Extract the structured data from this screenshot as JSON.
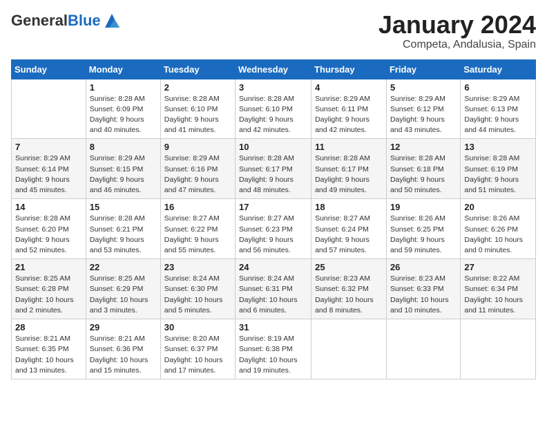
{
  "header": {
    "logo_general": "General",
    "logo_blue": "Blue",
    "month_title": "January 2024",
    "location": "Competa, Andalusia, Spain"
  },
  "weekdays": [
    "Sunday",
    "Monday",
    "Tuesday",
    "Wednesday",
    "Thursday",
    "Friday",
    "Saturday"
  ],
  "weeks": [
    [
      {
        "day": "",
        "info": ""
      },
      {
        "day": "1",
        "info": "Sunrise: 8:28 AM\nSunset: 6:09 PM\nDaylight: 9 hours\nand 40 minutes."
      },
      {
        "day": "2",
        "info": "Sunrise: 8:28 AM\nSunset: 6:10 PM\nDaylight: 9 hours\nand 41 minutes."
      },
      {
        "day": "3",
        "info": "Sunrise: 8:28 AM\nSunset: 6:10 PM\nDaylight: 9 hours\nand 42 minutes."
      },
      {
        "day": "4",
        "info": "Sunrise: 8:29 AM\nSunset: 6:11 PM\nDaylight: 9 hours\nand 42 minutes."
      },
      {
        "day": "5",
        "info": "Sunrise: 8:29 AM\nSunset: 6:12 PM\nDaylight: 9 hours\nand 43 minutes."
      },
      {
        "day": "6",
        "info": "Sunrise: 8:29 AM\nSunset: 6:13 PM\nDaylight: 9 hours\nand 44 minutes."
      }
    ],
    [
      {
        "day": "7",
        "info": "Sunrise: 8:29 AM\nSunset: 6:14 PM\nDaylight: 9 hours\nand 45 minutes."
      },
      {
        "day": "8",
        "info": "Sunrise: 8:29 AM\nSunset: 6:15 PM\nDaylight: 9 hours\nand 46 minutes."
      },
      {
        "day": "9",
        "info": "Sunrise: 8:29 AM\nSunset: 6:16 PM\nDaylight: 9 hours\nand 47 minutes."
      },
      {
        "day": "10",
        "info": "Sunrise: 8:28 AM\nSunset: 6:17 PM\nDaylight: 9 hours\nand 48 minutes."
      },
      {
        "day": "11",
        "info": "Sunrise: 8:28 AM\nSunset: 6:17 PM\nDaylight: 9 hours\nand 49 minutes."
      },
      {
        "day": "12",
        "info": "Sunrise: 8:28 AM\nSunset: 6:18 PM\nDaylight: 9 hours\nand 50 minutes."
      },
      {
        "day": "13",
        "info": "Sunrise: 8:28 AM\nSunset: 6:19 PM\nDaylight: 9 hours\nand 51 minutes."
      }
    ],
    [
      {
        "day": "14",
        "info": "Sunrise: 8:28 AM\nSunset: 6:20 PM\nDaylight: 9 hours\nand 52 minutes."
      },
      {
        "day": "15",
        "info": "Sunrise: 8:28 AM\nSunset: 6:21 PM\nDaylight: 9 hours\nand 53 minutes."
      },
      {
        "day": "16",
        "info": "Sunrise: 8:27 AM\nSunset: 6:22 PM\nDaylight: 9 hours\nand 55 minutes."
      },
      {
        "day": "17",
        "info": "Sunrise: 8:27 AM\nSunset: 6:23 PM\nDaylight: 9 hours\nand 56 minutes."
      },
      {
        "day": "18",
        "info": "Sunrise: 8:27 AM\nSunset: 6:24 PM\nDaylight: 9 hours\nand 57 minutes."
      },
      {
        "day": "19",
        "info": "Sunrise: 8:26 AM\nSunset: 6:25 PM\nDaylight: 9 hours\nand 59 minutes."
      },
      {
        "day": "20",
        "info": "Sunrise: 8:26 AM\nSunset: 6:26 PM\nDaylight: 10 hours\nand 0 minutes."
      }
    ],
    [
      {
        "day": "21",
        "info": "Sunrise: 8:25 AM\nSunset: 6:28 PM\nDaylight: 10 hours\nand 2 minutes."
      },
      {
        "day": "22",
        "info": "Sunrise: 8:25 AM\nSunset: 6:29 PM\nDaylight: 10 hours\nand 3 minutes."
      },
      {
        "day": "23",
        "info": "Sunrise: 8:24 AM\nSunset: 6:30 PM\nDaylight: 10 hours\nand 5 minutes."
      },
      {
        "day": "24",
        "info": "Sunrise: 8:24 AM\nSunset: 6:31 PM\nDaylight: 10 hours\nand 6 minutes."
      },
      {
        "day": "25",
        "info": "Sunrise: 8:23 AM\nSunset: 6:32 PM\nDaylight: 10 hours\nand 8 minutes."
      },
      {
        "day": "26",
        "info": "Sunrise: 8:23 AM\nSunset: 6:33 PM\nDaylight: 10 hours\nand 10 minutes."
      },
      {
        "day": "27",
        "info": "Sunrise: 8:22 AM\nSunset: 6:34 PM\nDaylight: 10 hours\nand 11 minutes."
      }
    ],
    [
      {
        "day": "28",
        "info": "Sunrise: 8:21 AM\nSunset: 6:35 PM\nDaylight: 10 hours\nand 13 minutes."
      },
      {
        "day": "29",
        "info": "Sunrise: 8:21 AM\nSunset: 6:36 PM\nDaylight: 10 hours\nand 15 minutes."
      },
      {
        "day": "30",
        "info": "Sunrise: 8:20 AM\nSunset: 6:37 PM\nDaylight: 10 hours\nand 17 minutes."
      },
      {
        "day": "31",
        "info": "Sunrise: 8:19 AM\nSunset: 6:38 PM\nDaylight: 10 hours\nand 19 minutes."
      },
      {
        "day": "",
        "info": ""
      },
      {
        "day": "",
        "info": ""
      },
      {
        "day": "",
        "info": ""
      }
    ]
  ]
}
